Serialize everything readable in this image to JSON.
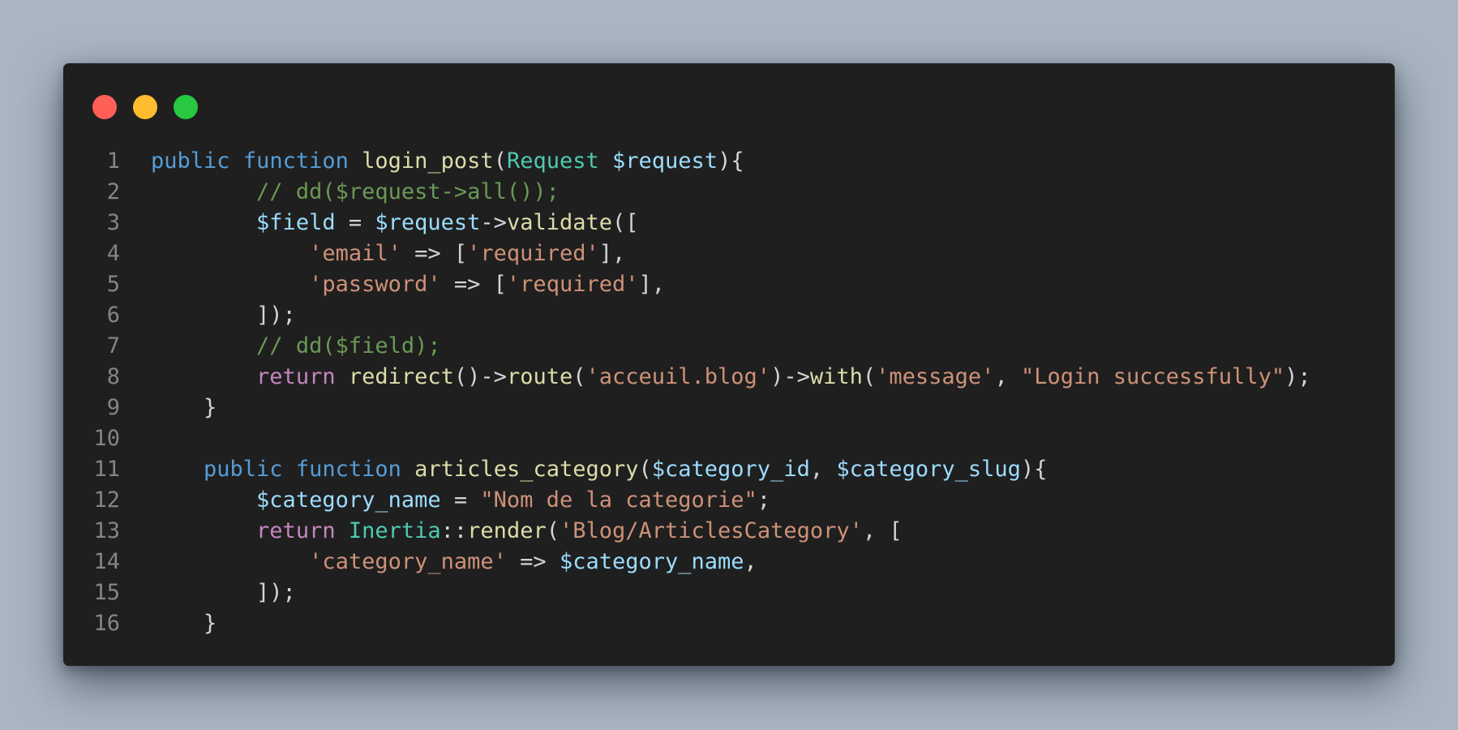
{
  "window": {
    "buttons": [
      {
        "name": "close-button",
        "color": "#ff5f57"
      },
      {
        "name": "minimize-button",
        "color": "#febc2e"
      },
      {
        "name": "maximize-button",
        "color": "#28c840"
      }
    ]
  },
  "code": {
    "lines": [
      {
        "number": "1",
        "tokens": [
          {
            "text": "public",
            "kind": "keyword"
          },
          {
            "text": " ",
            "kind": "plain"
          },
          {
            "text": "function",
            "kind": "keyword"
          },
          {
            "text": " ",
            "kind": "plain"
          },
          {
            "text": "login_post",
            "kind": "function"
          },
          {
            "text": "(",
            "kind": "plain"
          },
          {
            "text": "Request",
            "kind": "type"
          },
          {
            "text": " ",
            "kind": "plain"
          },
          {
            "text": "$request",
            "kind": "variable"
          },
          {
            "text": "){",
            "kind": "plain"
          }
        ]
      },
      {
        "number": "2",
        "tokens": [
          {
            "text": "        ",
            "kind": "plain"
          },
          {
            "text": "// dd($request->all());",
            "kind": "comment"
          }
        ]
      },
      {
        "number": "3",
        "tokens": [
          {
            "text": "        ",
            "kind": "plain"
          },
          {
            "text": "$field",
            "kind": "variable"
          },
          {
            "text": " = ",
            "kind": "plain"
          },
          {
            "text": "$request",
            "kind": "variable"
          },
          {
            "text": "->",
            "kind": "plain"
          },
          {
            "text": "validate",
            "kind": "function"
          },
          {
            "text": "([",
            "kind": "plain"
          }
        ]
      },
      {
        "number": "4",
        "tokens": [
          {
            "text": "            ",
            "kind": "plain"
          },
          {
            "text": "'email'",
            "kind": "string"
          },
          {
            "text": " => [",
            "kind": "plain"
          },
          {
            "text": "'required'",
            "kind": "string"
          },
          {
            "text": "],",
            "kind": "plain"
          }
        ]
      },
      {
        "number": "5",
        "tokens": [
          {
            "text": "            ",
            "kind": "plain"
          },
          {
            "text": "'password'",
            "kind": "string"
          },
          {
            "text": " => [",
            "kind": "plain"
          },
          {
            "text": "'required'",
            "kind": "string"
          },
          {
            "text": "],",
            "kind": "plain"
          }
        ]
      },
      {
        "number": "6",
        "tokens": [
          {
            "text": "        ",
            "kind": "plain"
          },
          {
            "text": "]);",
            "kind": "plain"
          }
        ]
      },
      {
        "number": "7",
        "tokens": [
          {
            "text": "        ",
            "kind": "plain"
          },
          {
            "text": "// dd($field);",
            "kind": "comment"
          }
        ]
      },
      {
        "number": "8",
        "tokens": [
          {
            "text": "        ",
            "kind": "plain"
          },
          {
            "text": "return",
            "kind": "control"
          },
          {
            "text": " ",
            "kind": "plain"
          },
          {
            "text": "redirect",
            "kind": "function"
          },
          {
            "text": "()->",
            "kind": "plain"
          },
          {
            "text": "route",
            "kind": "function"
          },
          {
            "text": "(",
            "kind": "plain"
          },
          {
            "text": "'acceuil.blog'",
            "kind": "string"
          },
          {
            "text": ")->",
            "kind": "plain"
          },
          {
            "text": "with",
            "kind": "function"
          },
          {
            "text": "(",
            "kind": "plain"
          },
          {
            "text": "'message'",
            "kind": "string"
          },
          {
            "text": ", ",
            "kind": "plain"
          },
          {
            "text": "\"Login successfully\"",
            "kind": "string"
          },
          {
            "text": ");",
            "kind": "plain"
          }
        ]
      },
      {
        "number": "9",
        "tokens": [
          {
            "text": "    ",
            "kind": "plain"
          },
          {
            "text": "}",
            "kind": "plain"
          }
        ]
      },
      {
        "number": "10",
        "tokens": []
      },
      {
        "number": "11",
        "tokens": [
          {
            "text": "    ",
            "kind": "plain"
          },
          {
            "text": "public",
            "kind": "keyword"
          },
          {
            "text": " ",
            "kind": "plain"
          },
          {
            "text": "function",
            "kind": "keyword"
          },
          {
            "text": " ",
            "kind": "plain"
          },
          {
            "text": "articles_category",
            "kind": "function"
          },
          {
            "text": "(",
            "kind": "plain"
          },
          {
            "text": "$category_id",
            "kind": "variable"
          },
          {
            "text": ", ",
            "kind": "plain"
          },
          {
            "text": "$category_slug",
            "kind": "variable"
          },
          {
            "text": "){",
            "kind": "plain"
          }
        ]
      },
      {
        "number": "12",
        "tokens": [
          {
            "text": "        ",
            "kind": "plain"
          },
          {
            "text": "$category_name",
            "kind": "variable"
          },
          {
            "text": " = ",
            "kind": "plain"
          },
          {
            "text": "\"Nom de la categorie\"",
            "kind": "string"
          },
          {
            "text": ";",
            "kind": "plain"
          }
        ]
      },
      {
        "number": "13",
        "tokens": [
          {
            "text": "        ",
            "kind": "plain"
          },
          {
            "text": "return",
            "kind": "control"
          },
          {
            "text": " ",
            "kind": "plain"
          },
          {
            "text": "Inertia",
            "kind": "type"
          },
          {
            "text": "::",
            "kind": "plain"
          },
          {
            "text": "render",
            "kind": "function"
          },
          {
            "text": "(",
            "kind": "plain"
          },
          {
            "text": "'Blog/ArticlesCategory'",
            "kind": "string"
          },
          {
            "text": ", [",
            "kind": "plain"
          }
        ]
      },
      {
        "number": "14",
        "tokens": [
          {
            "text": "            ",
            "kind": "plain"
          },
          {
            "text": "'category_name'",
            "kind": "string"
          },
          {
            "text": " => ",
            "kind": "plain"
          },
          {
            "text": "$category_name",
            "kind": "variable"
          },
          {
            "text": ",",
            "kind": "plain"
          }
        ]
      },
      {
        "number": "15",
        "tokens": [
          {
            "text": "        ",
            "kind": "plain"
          },
          {
            "text": "]);",
            "kind": "plain"
          }
        ]
      },
      {
        "number": "16",
        "tokens": [
          {
            "text": "    ",
            "kind": "plain"
          },
          {
            "text": "}",
            "kind": "plain"
          }
        ]
      }
    ]
  }
}
